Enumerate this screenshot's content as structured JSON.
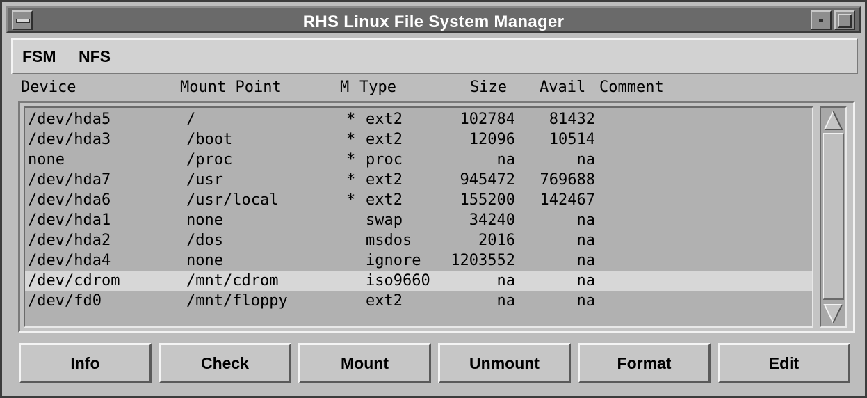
{
  "window": {
    "title": "RHS Linux File System Manager"
  },
  "menubar": {
    "items": [
      "FSM",
      "NFS"
    ]
  },
  "table": {
    "headers": [
      "Device",
      "Mount Point",
      "M",
      "Type",
      "Size",
      "Avail",
      "Comment"
    ],
    "rows": [
      [
        "/dev/hda5",
        "/",
        "*",
        "ext2",
        "102784",
        "81432",
        ""
      ],
      [
        "/dev/hda3",
        "/boot",
        "*",
        "ext2",
        "12096",
        "10514",
        ""
      ],
      [
        "none",
        "/proc",
        "*",
        "proc",
        "na",
        "na",
        ""
      ],
      [
        "/dev/hda7",
        "/usr",
        "*",
        "ext2",
        "945472",
        "769688",
        ""
      ],
      [
        "/dev/hda6",
        "/usr/local",
        "*",
        "ext2",
        "155200",
        "142467",
        ""
      ],
      [
        "/dev/hda1",
        "none",
        "",
        "swap",
        "34240",
        "na",
        ""
      ],
      [
        "/dev/hda2",
        "/dos",
        "",
        "msdos",
        "2016",
        "na",
        ""
      ],
      [
        "/dev/hda4",
        "none",
        "",
        "ignore",
        "1203552",
        "na",
        ""
      ],
      [
        "/dev/cdrom",
        "/mnt/cdrom",
        "",
        "iso9660",
        "na",
        "na",
        ""
      ],
      [
        "/dev/fd0",
        "/mnt/floppy",
        "",
        "ext2",
        "na",
        "na",
        ""
      ]
    ],
    "selected_row": 8
  },
  "buttons": [
    "Info",
    "Check",
    "Mount",
    "Unmount",
    "Format",
    "Edit"
  ],
  "icons": {
    "window_menu": "window-menu-icon",
    "minimize": "minimize-icon",
    "maximize": "maximize-icon",
    "scroll_up": "scroll-up-arrow-icon",
    "scroll_down": "scroll-down-arrow-icon"
  },
  "colors": {
    "window_bg": "#bdbdbd",
    "title_bg": "#6a6a6a",
    "list_bg": "#b1b1b1",
    "selected_row_bg": "#d7d7d7"
  }
}
